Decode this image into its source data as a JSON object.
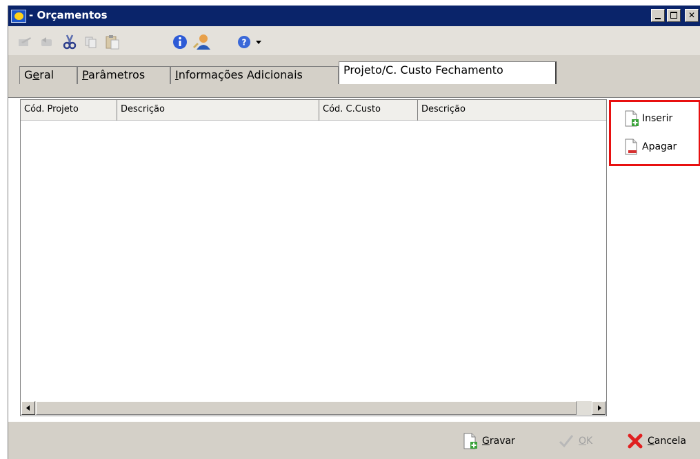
{
  "window": {
    "title": "- Orçamentos"
  },
  "toolbar": {
    "icons": [
      "edit-icon",
      "undo-icon",
      "cut-icon",
      "copy-icon",
      "paste-icon",
      "info-icon",
      "user-icon",
      "help-icon",
      "dropdown-arrow-icon"
    ]
  },
  "tabs": [
    {
      "prefix": "G",
      "hot": "e",
      "rest": "ral"
    },
    {
      "prefix": "",
      "hot": "P",
      "rest": "arâmetros"
    },
    {
      "prefix": "",
      "hot": "I",
      "rest": "nformações Adicionais"
    },
    {
      "prefix": "",
      "hot": "",
      "rest": "Projeto/C. Custo Fechamento"
    }
  ],
  "grid": {
    "columns": [
      "Cód. Projeto",
      "Descrição",
      "Cód. C.Custo",
      "Descrição"
    ],
    "rows": []
  },
  "side_actions": {
    "insert_label": "Inserir",
    "delete_label": "Apagar"
  },
  "footer": {
    "save_hot": "G",
    "save_rest": "ravar",
    "ok_hot": "O",
    "ok_rest": "K",
    "cancel_hot": "C",
    "cancel_rest": "ancela"
  },
  "colors": {
    "titlebar": "#0a246a",
    "window_bg": "#d4d0c8",
    "highlight_box": "#e81010"
  }
}
